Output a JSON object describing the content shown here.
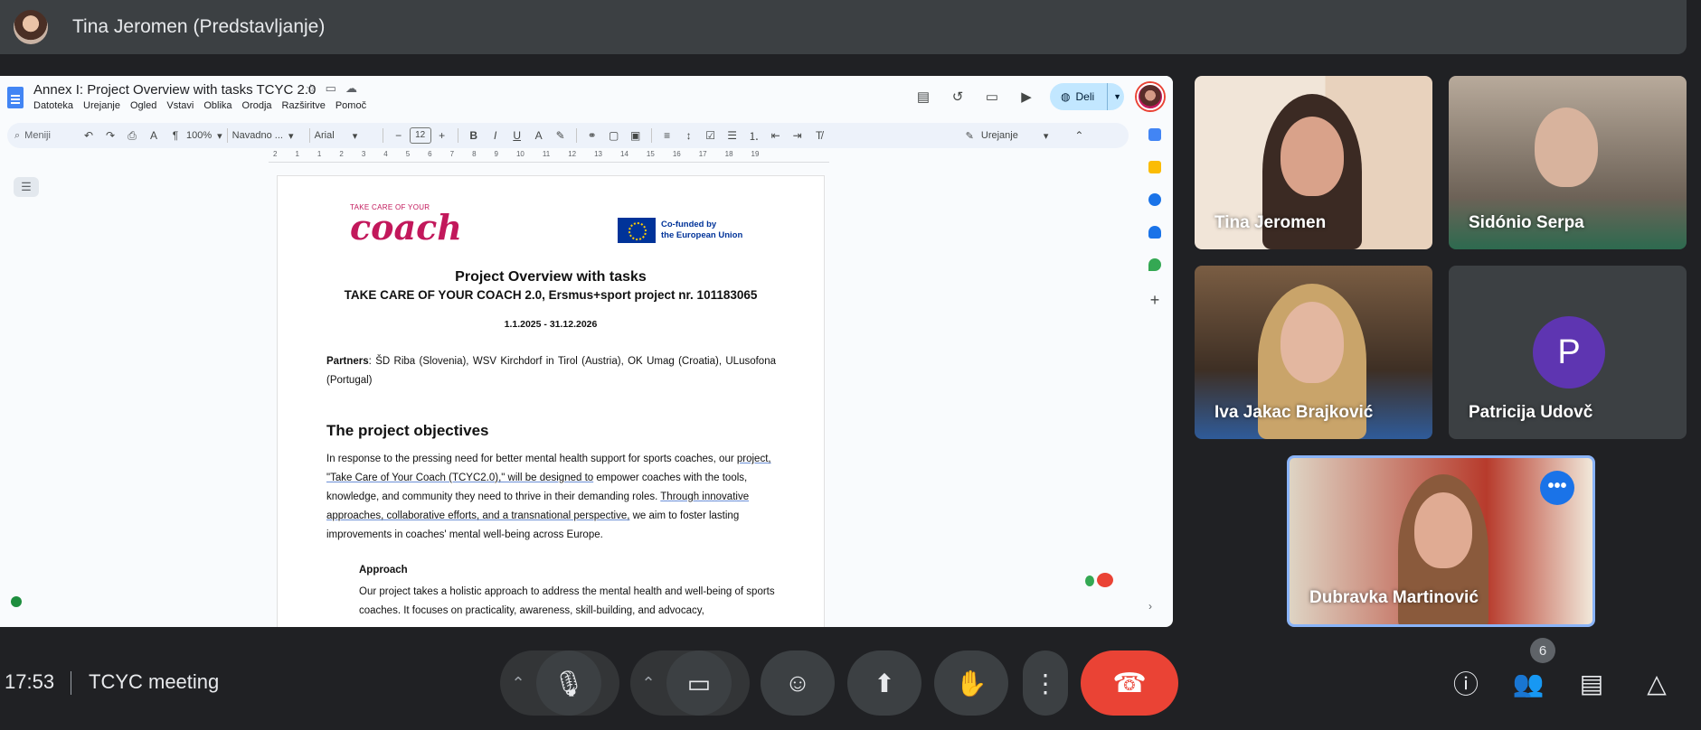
{
  "presenter": {
    "title": "Tina Jeromen (Predstavljanje)"
  },
  "doc": {
    "title": "Annex I: Project Overview with tasks  TCYC 2.0",
    "menu": [
      "Datoteka",
      "Urejanje",
      "Ogled",
      "Vstavi",
      "Oblika",
      "Orodja",
      "Razširitve",
      "Pomoč"
    ],
    "share_label": "Deli",
    "toolbar": {
      "search": "Meniji",
      "zoom": "100%",
      "style": "Navadno ...",
      "font": "Arial",
      "font_size": "12",
      "mode": "Urejanje"
    },
    "ruler": [
      "2",
      "1",
      "1",
      "2",
      "3",
      "4",
      "5",
      "6",
      "7",
      "8",
      "9",
      "10",
      "11",
      "12",
      "13",
      "14",
      "15",
      "16",
      "17",
      "18",
      "19"
    ],
    "content": {
      "logo_small": "TAKE CARE OF YOUR",
      "logo_big": "coach",
      "eu_line1": "Co-funded by",
      "eu_line2": "the European Union",
      "title": "Project Overview with tasks",
      "subtitle": "TAKE CARE OF YOUR COACH 2.0, Ersmus+sport project nr. 101183065",
      "dates": "1.1.2025 - 31.12.2026",
      "partners_label": "Partners",
      "partners_text": ": ŠD Riba (Slovenia), WSV Kirchdorf in Tirol (Austria), OK Umag (Croatia), ULusofona (Portugal)",
      "objectives_heading": "The project objectives",
      "para_1": "In response to the pressing need for better mental health support for sports coaches, our ",
      "para_2": "project, \"Take Care of Your Coach (TCYC2.0),\" will be designed to",
      "para_3": " empower coaches with the tools, knowledge, and community they need to thrive in their demanding roles. ",
      "para_4": "Through innovative approaches, collaborative efforts, and a transnational perspective,",
      "para_5": " we aim to foster lasting improvements in coaches' mental well-being across Europe.",
      "approach_heading": "Approach",
      "approach_text": "Our project takes a holistic approach to address the mental health and well-being of sports coaches. It focuses on practicality, awareness, skill-building, and advocacy,"
    }
  },
  "participants": [
    {
      "name": "Tina Jeromen"
    },
    {
      "name": "Sidónio Serpa"
    },
    {
      "name": "Iva Jakac Brajković"
    },
    {
      "name": "Patricija Udovč",
      "initial": "P"
    },
    {
      "name": "Dubravka Martinović"
    }
  ],
  "footer": {
    "time": "17:53",
    "meeting": "TCYC meeting",
    "participant_count": "6"
  },
  "colors": {
    "hangup": "#ea4335",
    "accent": "#1a73e8",
    "avatar_purple": "#5e35b1"
  }
}
